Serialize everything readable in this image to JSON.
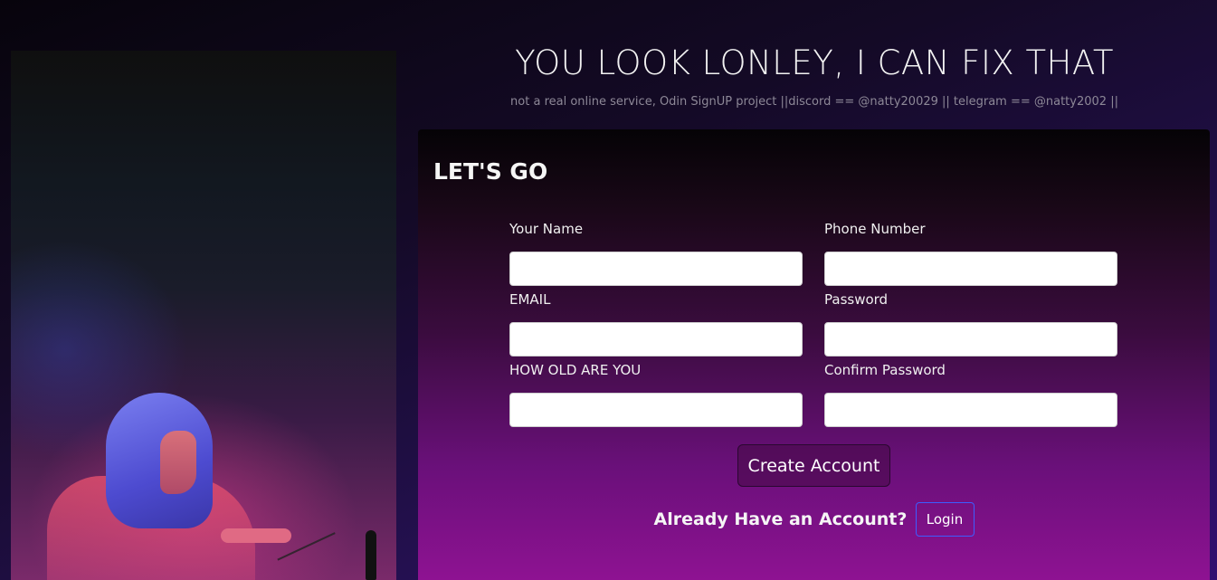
{
  "header": {
    "title": "YOU LOOK LONLEY, I CAN FIX THAT",
    "subtitle": "not a real online service, Odin SignUP project ||discord == @natty20029 || telegram == @natty2002 ||"
  },
  "form": {
    "heading": "LET'S GO",
    "fields": {
      "name": {
        "label": "Your Name",
        "value": ""
      },
      "phone": {
        "label": "Phone Number",
        "value": ""
      },
      "email": {
        "label": "EMAIL",
        "value": ""
      },
      "password": {
        "label": "Password",
        "value": ""
      },
      "age": {
        "label": "HOW OLD ARE YOU",
        "value": ""
      },
      "confirm_password": {
        "label": "Confirm Password",
        "value": ""
      }
    },
    "create_button_label": "Create Account",
    "login_prompt": "Already Have an Account?",
    "login_button_label": "Login"
  },
  "colors": {
    "card_top": "#050306",
    "card_bottom": "#8e1292",
    "login_border": "#3d5dff"
  }
}
